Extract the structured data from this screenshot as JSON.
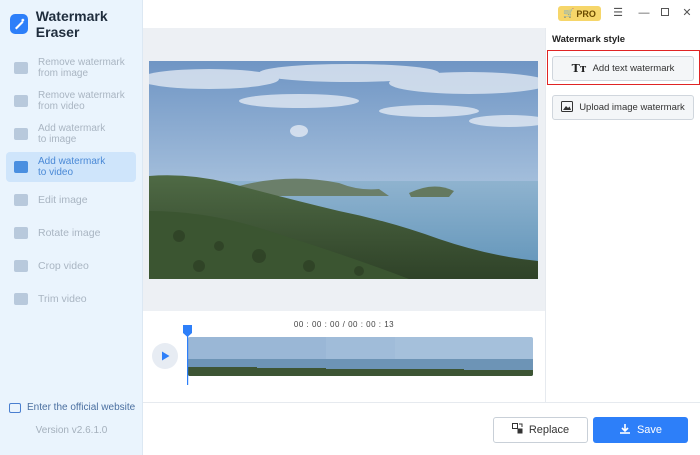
{
  "app": {
    "title": "Watermark Eraser",
    "version": "Version v2.6.1.0"
  },
  "sidebar": {
    "items": [
      {
        "label": "Remove watermark\nfrom image",
        "icon": "image-erase-icon",
        "active": false
      },
      {
        "label": "Remove watermark\nfrom video",
        "icon": "video-erase-icon",
        "active": false
      },
      {
        "label": "Add watermark\nto image",
        "icon": "image-add-icon",
        "active": false
      },
      {
        "label": "Add watermark\nto video",
        "icon": "video-add-icon",
        "active": true
      },
      {
        "label": "Edit image",
        "icon": "edit-image-icon",
        "active": false
      },
      {
        "label": "Rotate image",
        "icon": "rotate-image-icon",
        "active": false
      },
      {
        "label": "Crop video",
        "icon": "crop-video-icon",
        "active": false
      },
      {
        "label": "Trim video",
        "icon": "trim-video-icon",
        "active": false
      }
    ],
    "website_link": "Enter the official website"
  },
  "titlebar": {
    "pro_label": "PRO",
    "buttons": [
      "menu-icon",
      "minimize-icon",
      "maximize-icon",
      "close-icon"
    ]
  },
  "timeline": {
    "timecode": "00 : 00 : 00 / 00 : 00 : 13"
  },
  "panel": {
    "title": "Watermark style",
    "add_text_label": "Add text watermark",
    "add_text_icon": "Tт",
    "upload_image_label": "Upload image watermark"
  },
  "actions": {
    "replace_label": "Replace",
    "save_label": "Save"
  },
  "colors": {
    "accent": "#2d7ff9",
    "highlight": "#e02424",
    "pro_badge": "#f6d66a",
    "sidebar_bg": "#eaf4fd"
  }
}
